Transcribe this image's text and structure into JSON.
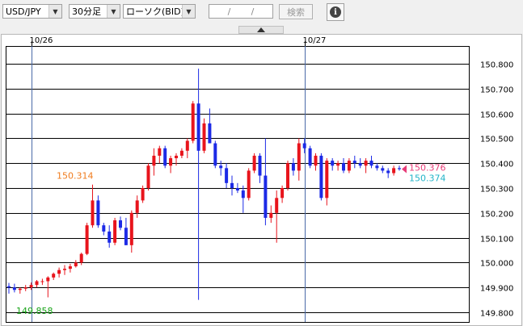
{
  "toolbar": {
    "pair": "USD/JPY",
    "timeframe": "30分足",
    "chart_type": "ローソク(BID)",
    "date_sep1": "/",
    "date_sep2": "/",
    "search_label": "検索",
    "info_label": "i"
  },
  "colors": {
    "up": "#e8141c",
    "down": "#1c2ae6",
    "bid": "#e83c78",
    "ask": "#22b4c8",
    "high": "#f07c1e",
    "low": "#18a418"
  },
  "chart_data": {
    "type": "candlestick",
    "x_labels": [
      {
        "index": 4,
        "label": "10/26"
      },
      {
        "index": 53,
        "label": "10/27"
      }
    ],
    "yticks": [
      "150.800",
      "150.700",
      "150.600",
      "150.500",
      "150.400",
      "150.300",
      "150.200",
      "150.100",
      "150.000",
      "149.900",
      "149.800"
    ],
    "ylim": [
      149.8,
      150.8
    ],
    "annotations": {
      "high": "150.314",
      "low": "149.858",
      "bid": "150.376",
      "ask": "150.374"
    },
    "candles": [
      [
        149.905,
        149.918,
        149.875,
        149.9
      ],
      [
        149.9,
        149.915,
        149.88,
        149.89
      ],
      [
        149.89,
        149.9,
        149.875,
        149.895
      ],
      [
        149.895,
        149.91,
        149.885,
        149.9
      ],
      [
        149.9,
        149.92,
        149.89,
        149.91
      ],
      [
        149.91,
        149.93,
        149.9,
        149.925
      ],
      [
        149.925,
        149.935,
        149.91,
        149.925
      ],
      [
        149.925,
        149.945,
        149.86,
        149.94
      ],
      [
        149.94,
        149.96,
        149.93,
        149.955
      ],
      [
        149.955,
        149.98,
        149.94,
        149.97
      ],
      [
        149.97,
        149.99,
        149.95,
        149.975
      ],
      [
        149.975,
        149.995,
        149.96,
        149.985
      ],
      [
        149.985,
        150.01,
        149.98,
        150.0
      ],
      [
        150.0,
        150.04,
        149.99,
        150.035
      ],
      [
        150.035,
        150.16,
        150.03,
        150.15
      ],
      [
        150.15,
        150.314,
        150.14,
        150.25
      ],
      [
        150.25,
        150.27,
        150.14,
        150.15
      ],
      [
        150.15,
        150.16,
        150.11,
        150.125
      ],
      [
        150.125,
        150.15,
        150.06,
        150.08
      ],
      [
        150.08,
        150.18,
        150.07,
        150.17
      ],
      [
        150.17,
        150.185,
        150.13,
        150.14
      ],
      [
        150.14,
        150.18,
        150.07,
        150.07
      ],
      [
        150.07,
        150.21,
        150.04,
        150.2
      ],
      [
        150.2,
        150.27,
        150.18,
        150.25
      ],
      [
        150.25,
        150.31,
        150.24,
        150.3
      ],
      [
        150.3,
        150.4,
        150.29,
        150.39
      ],
      [
        150.39,
        150.46,
        150.35,
        150.43
      ],
      [
        150.43,
        150.47,
        150.4,
        150.46
      ],
      [
        150.46,
        150.47,
        150.38,
        150.39
      ],
      [
        150.39,
        150.43,
        150.36,
        150.42
      ],
      [
        150.42,
        150.44,
        150.39,
        150.43
      ],
      [
        150.43,
        150.46,
        150.42,
        150.45
      ],
      [
        150.45,
        150.5,
        150.42,
        150.49
      ],
      [
        150.49,
        150.65,
        150.48,
        150.64
      ],
      [
        150.64,
        150.78,
        149.85,
        150.45
      ],
      [
        150.45,
        150.58,
        150.44,
        150.56
      ],
      [
        150.56,
        150.62,
        150.5,
        150.48
      ],
      [
        150.48,
        150.49,
        150.38,
        150.39
      ],
      [
        150.39,
        150.41,
        150.35,
        150.38
      ],
      [
        150.38,
        150.4,
        150.3,
        150.32
      ],
      [
        150.32,
        150.35,
        150.27,
        150.3
      ],
      [
        150.3,
        150.32,
        150.28,
        150.29
      ],
      [
        150.29,
        150.31,
        150.2,
        150.26
      ],
      [
        150.26,
        150.38,
        150.25,
        150.37
      ],
      [
        150.37,
        150.44,
        150.36,
        150.43
      ],
      [
        150.43,
        150.44,
        150.32,
        150.35
      ],
      [
        150.35,
        150.5,
        150.15,
        150.18
      ],
      [
        150.18,
        150.23,
        150.16,
        150.2
      ],
      [
        150.2,
        150.29,
        150.08,
        150.26
      ],
      [
        150.26,
        150.31,
        150.24,
        150.3
      ],
      [
        150.3,
        150.41,
        150.29,
        150.4
      ],
      [
        150.4,
        150.42,
        150.35,
        150.37
      ],
      [
        150.37,
        150.5,
        150.33,
        150.48
      ],
      [
        150.48,
        150.5,
        150.44,
        150.46
      ],
      [
        150.46,
        150.47,
        150.38,
        150.39
      ],
      [
        150.39,
        150.44,
        150.37,
        150.43
      ],
      [
        150.43,
        150.44,
        150.25,
        150.26
      ],
      [
        150.26,
        150.42,
        150.23,
        150.41
      ],
      [
        150.41,
        150.42,
        150.37,
        150.39
      ],
      [
        150.39,
        150.41,
        150.37,
        150.4
      ],
      [
        150.4,
        150.42,
        150.36,
        150.37
      ],
      [
        150.37,
        150.42,
        150.36,
        150.41
      ],
      [
        150.41,
        150.43,
        150.38,
        150.4
      ],
      [
        150.4,
        150.42,
        150.38,
        150.39
      ],
      [
        150.39,
        150.42,
        150.36,
        150.41
      ],
      [
        150.41,
        150.43,
        150.38,
        150.39
      ],
      [
        150.39,
        150.4,
        150.37,
        150.38
      ],
      [
        150.38,
        150.39,
        150.36,
        150.37
      ],
      [
        150.37,
        150.38,
        150.34,
        150.36
      ],
      [
        150.36,
        150.39,
        150.35,
        150.38
      ],
      [
        150.38,
        150.39,
        150.37,
        150.376
      ]
    ]
  }
}
